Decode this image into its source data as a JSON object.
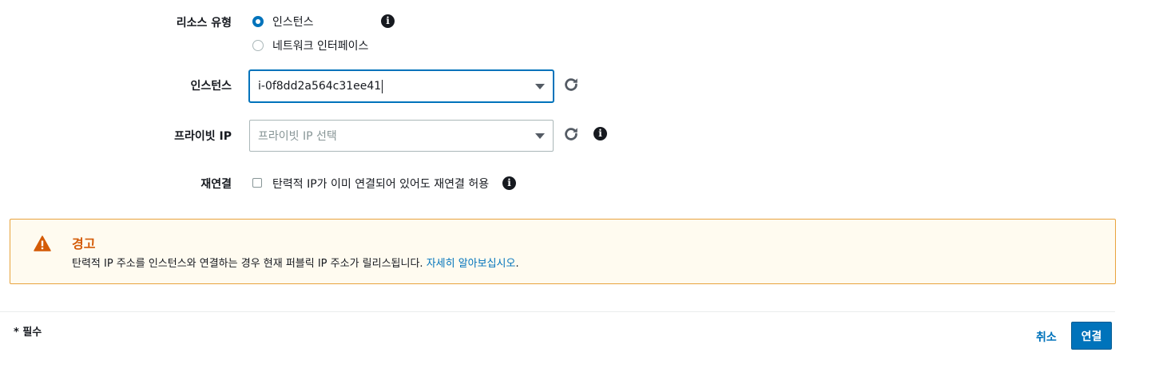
{
  "form": {
    "resource_type": {
      "label": "리소스 유형",
      "options": [
        {
          "label": "인스턴스",
          "selected": true
        },
        {
          "label": "네트워크 인터페이스",
          "selected": false
        }
      ]
    },
    "instance": {
      "label": "인스턴스",
      "value": "i-0f8dd2a564c31ee41"
    },
    "private_ip": {
      "label": "프라이빗 IP",
      "placeholder": "프라이빗 IP 선택"
    },
    "reassociation": {
      "label": "재연결",
      "checkbox_label": "탄력적 IP가 이미 연결되어 있어도 재연결 허용",
      "checked": false
    }
  },
  "warning": {
    "title": "경고",
    "message": "탄력적 IP 주소를 인스턴스와 연결하는 경우 현재 퍼블릭 IP 주소가 릴리스됩니다.",
    "link": "자세히 알아보십시오",
    "suffix": "."
  },
  "footer": {
    "required_note": "* 필수",
    "cancel_label": "취소",
    "connect_label": "연결"
  },
  "colors": {
    "accent": "#0073bb",
    "warning_border": "#e8a33d",
    "warning_bg": "#fffbf0",
    "warning_title": "#d45b07"
  },
  "icons": {
    "info": "info-icon",
    "refresh": "refresh-icon",
    "warning": "warning-triangle-icon",
    "dropdown": "caret-down-icon"
  }
}
